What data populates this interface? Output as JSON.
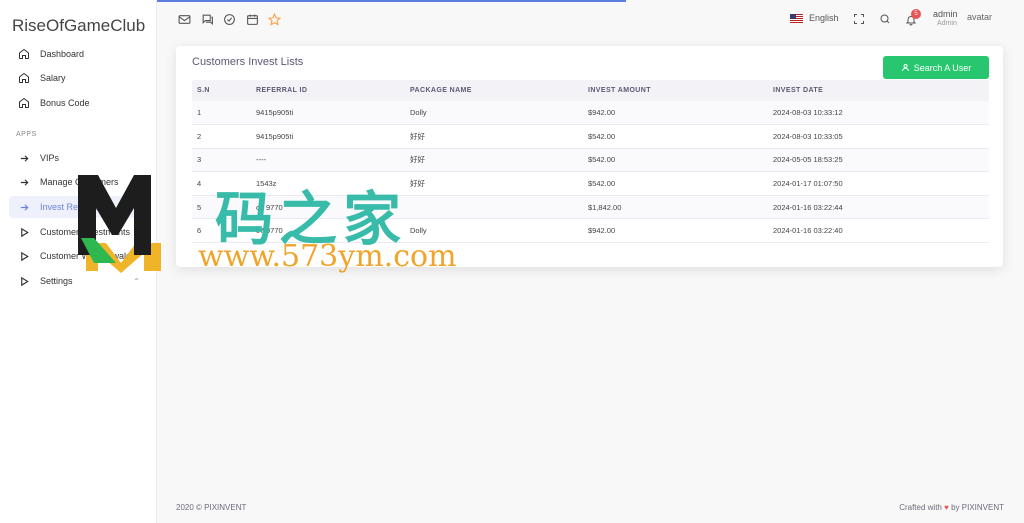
{
  "brand": "RiseOfGameClub",
  "sidebar": {
    "items": [
      {
        "label": "Dashboard"
      },
      {
        "label": "Salary"
      },
      {
        "label": "Bonus Code"
      }
    ],
    "section_label": "APPS",
    "apps": [
      {
        "label": "VIPs"
      },
      {
        "label": "Manage Customers"
      },
      {
        "label": "Invest Records"
      },
      {
        "label": "Customer Investments"
      },
      {
        "label": "Customer Withdrawals"
      },
      {
        "label": "Settings"
      }
    ]
  },
  "header": {
    "language": "English",
    "notification_count": "5",
    "user_name": "admin",
    "user_role": "Admin",
    "avatar_alt": "avatar"
  },
  "card": {
    "title": "Customers Invest Lists",
    "search_button": "Search A User",
    "columns": [
      "S.N",
      "REFERRAL ID",
      "PACKAGE NAME",
      "INVEST AMOUNT",
      "INVEST DATE"
    ],
    "rows": [
      [
        "1",
        "9415p905ti",
        "Dolly",
        "$942.00",
        "2024-08-03 10:33:12"
      ],
      [
        "2",
        "9415p905ti",
        "好好",
        "$542.00",
        "2024-08-03 10:33:05"
      ],
      [
        "3",
        "----",
        "好好",
        "$542.00",
        "2024-05-05 18:53:25"
      ],
      [
        "4",
        "1543z",
        "好好",
        "$542.00",
        "2024-01-17 01:07:50"
      ],
      [
        "5",
        "c7 9770",
        "",
        "$1,842.00",
        "2024-01-16 03:22:44"
      ],
      [
        "6",
        "c7 9770",
        "Dolly",
        "$942.00",
        "2024-01-16 03:22:40"
      ]
    ]
  },
  "footer": {
    "copyright": "2020 © PIXINVENT",
    "crafted_prefix": "Crafted with",
    "crafted_suffix": "by PIXINVENT"
  },
  "watermark": {
    "cn": "码之家",
    "url": "www.573ym.com"
  },
  "colors": {
    "accent": "#6d83d9",
    "success": "#28c76f",
    "danger": "#ea5455"
  }
}
